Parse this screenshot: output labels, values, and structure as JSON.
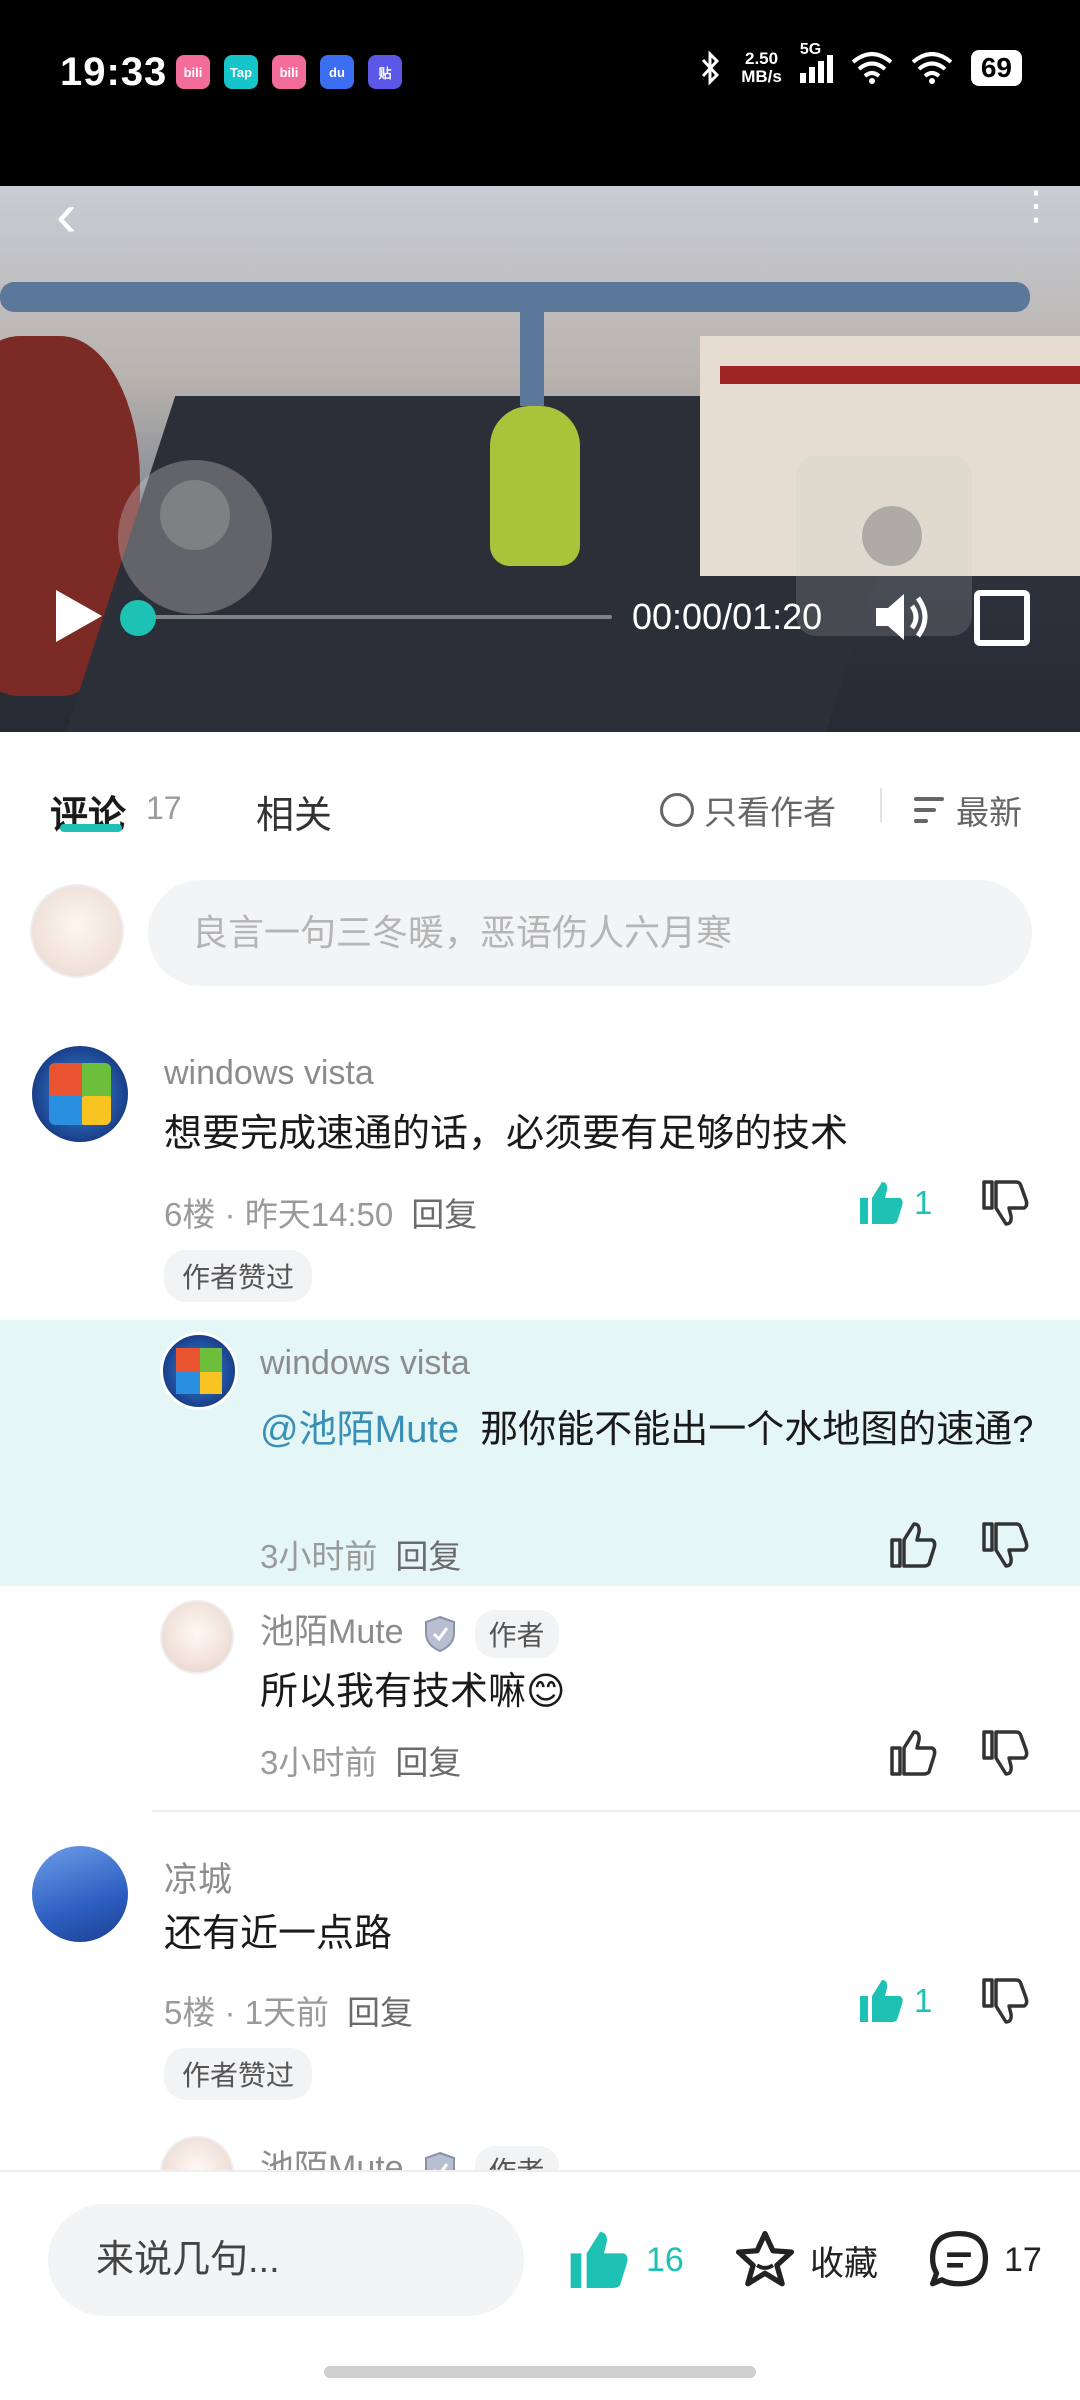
{
  "status_bar": {
    "time": "19:33",
    "apps": [
      {
        "name": "bilibili",
        "label": "bili",
        "color": "#f36c9a"
      },
      {
        "name": "taptap",
        "label": "Tap",
        "color": "#15c5c9"
      },
      {
        "name": "bilibili",
        "label": "bili",
        "color": "#f36c9a"
      },
      {
        "name": "baidu",
        "label": "du",
        "color": "#3b6ef0"
      },
      {
        "name": "tieba",
        "label": "贴",
        "color": "#5b58e8"
      }
    ],
    "net_speed_value": "2.50",
    "net_speed_unit": "MB/s",
    "signal_label": "5G",
    "battery": "69"
  },
  "video": {
    "timecode": "00:00/01:20",
    "progress": 0.0,
    "accent_color": "#1ec2b5"
  },
  "tabs": {
    "comments_label": "评论",
    "comments_count": "17",
    "related_label": "相关",
    "only_author_label": "只看作者",
    "sort_label": "最新"
  },
  "comment_input": {
    "placeholder": "良言一句三冬暖，恶语伤人六月寒"
  },
  "comments": [
    {
      "user": "windows vista",
      "text": "想要完成速通的话，必须要有足够的技术",
      "floor": "6楼",
      "time": "昨天14:50",
      "reply_label": "回复",
      "likes": "1",
      "badge": "作者赞过",
      "replies": [
        {
          "user": "windows vista",
          "mention": "@池陌Mute",
          "text": "那你能不能出一个水地图的速通?",
          "time": "3小时前",
          "reply_label": "回复"
        },
        {
          "user": "池陌Mute",
          "author_tag": "作者",
          "text": "所以我有技术嘛😊",
          "time": "3小时前",
          "reply_label": "回复"
        }
      ]
    },
    {
      "user": "凉城",
      "text": "还有近一点路",
      "floor": "5楼",
      "time": "1天前",
      "reply_label": "回复",
      "likes": "1",
      "badge": "作者赞过",
      "replies": [
        {
          "user": "池陌Mute",
          "author_tag": "作者"
        }
      ]
    }
  ],
  "bottom_bar": {
    "input_placeholder": "来说几句...",
    "likes": "16",
    "favorite_label": "收藏",
    "comments": "17"
  },
  "meta_separator": " · "
}
